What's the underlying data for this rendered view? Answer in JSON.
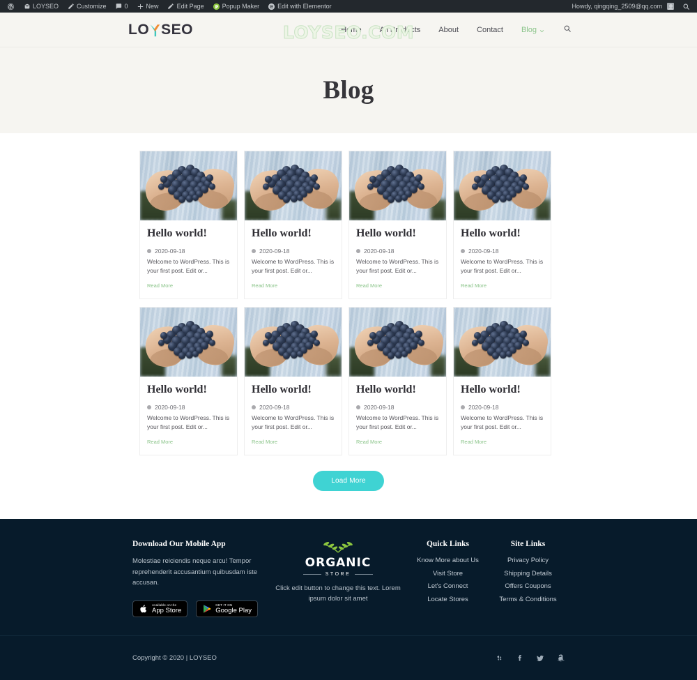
{
  "admin_bar": {
    "items": [
      {
        "icon": "wordpress-logo-icon",
        "label": ""
      },
      {
        "icon": "home-icon",
        "label": "LOYSEO"
      },
      {
        "icon": "pencil-icon",
        "label": "Customize"
      },
      {
        "icon": "comment-icon",
        "label": "0"
      },
      {
        "icon": "plus-icon",
        "label": "New"
      },
      {
        "icon": "edit-icon",
        "label": "Edit Page"
      },
      {
        "icon": "popup-maker-icon",
        "label": "Popup Maker"
      },
      {
        "icon": "elementor-icon",
        "label": "Edit with Elementor"
      }
    ],
    "howdy": "Howdy, qingqing_2509@qq.com",
    "search_icon": "search-icon"
  },
  "header": {
    "logo_before": "LO",
    "logo_after": "SEO",
    "watermark": "LOYSEO.COM",
    "nav": [
      {
        "label": "Home",
        "active": false,
        "has_chevron": false
      },
      {
        "label": "All Products",
        "active": false,
        "has_chevron": false
      },
      {
        "label": "About",
        "active": false,
        "has_chevron": false
      },
      {
        "label": "Contact",
        "active": false,
        "has_chevron": false
      },
      {
        "label": "Blog",
        "active": true,
        "has_chevron": true
      }
    ],
    "search_icon": "search-icon"
  },
  "hero": {
    "title": "Blog"
  },
  "blog": {
    "posts": [
      {
        "title": "Hello world!",
        "date": "2020-09-18",
        "excerpt": "Welcome to WordPress. This is your first post. Edit or...",
        "read_more": "Read More"
      },
      {
        "title": "Hello world!",
        "date": "2020-09-18",
        "excerpt": "Welcome to WordPress. This is your first post. Edit or...",
        "read_more": "Read More"
      },
      {
        "title": "Hello world!",
        "date": "2020-09-18",
        "excerpt": "Welcome to WordPress. This is your first post. Edit or...",
        "read_more": "Read More"
      },
      {
        "title": "Hello world!",
        "date": "2020-09-18",
        "excerpt": "Welcome to WordPress. This is your first post. Edit or...",
        "read_more": "Read More"
      },
      {
        "title": "Hello world!",
        "date": "2020-09-18",
        "excerpt": "Welcome to WordPress. This is your first post. Edit or...",
        "read_more": "Read More"
      },
      {
        "title": "Hello world!",
        "date": "2020-09-18",
        "excerpt": "Welcome to WordPress. This is your first post. Edit or...",
        "read_more": "Read More"
      },
      {
        "title": "Hello world!",
        "date": "2020-09-18",
        "excerpt": "Welcome to WordPress. This is your first post. Edit or...",
        "read_more": "Read More"
      },
      {
        "title": "Hello world!",
        "date": "2020-09-18",
        "excerpt": "Welcome to WordPress. This is your first post. Edit or...",
        "read_more": "Read More"
      }
    ],
    "load_more": "Load More"
  },
  "footer": {
    "app": {
      "heading": "Download Our Mobile App",
      "text": "Molestiae reiciendis neque arcu! Tempor reprehenderit accusantium quibusdam iste accusan.",
      "badges": [
        {
          "icon": "apple-icon",
          "small": "Available on the",
          "big": "App Store"
        },
        {
          "icon": "google-play-icon",
          "small": "GET IT ON",
          "big": "Google Play"
        }
      ]
    },
    "brand": {
      "word": "ORGANIC",
      "sub": "STORE",
      "tagline": "Click edit button to change this text. Lorem ipsum dolor sit amet"
    },
    "quick_links": {
      "heading": "Quick Links",
      "items": [
        "Know More about Us",
        "Visit Store",
        "Let's Connect",
        "Locate Stores"
      ]
    },
    "site_links": {
      "heading": "Site Links",
      "items": [
        "Privacy Policy",
        "Shipping Details",
        "Offers Coupons",
        "Terms & Conditions"
      ]
    },
    "copyright": "Copyright © 2020 | LOYSEO",
    "socials": [
      "yelp-icon",
      "facebook-icon",
      "twitter-icon",
      "amazon-icon"
    ]
  },
  "colors": {
    "accent_green": "#8bc48a",
    "accent_teal": "#3fd3d3",
    "footer_bg": "#071b2b",
    "hero_bg": "#f6f5f1",
    "adminbar_bg": "#23282d"
  }
}
